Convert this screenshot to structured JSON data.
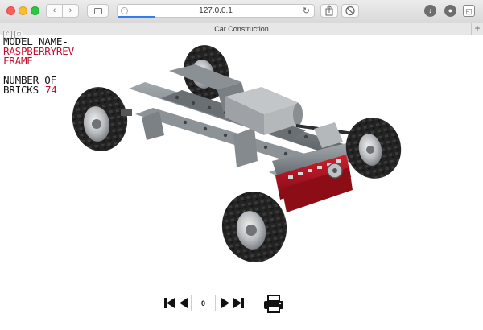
{
  "browser": {
    "url": "127.0.0.1",
    "tab_title": "Car Construction",
    "back_glyph": "‹",
    "forward_glyph": "›",
    "reload_glyph": "↻",
    "new_tab_glyph": "+",
    "icons": [
      "sidebar-icon",
      "share-icon",
      "tabs-icon",
      "download-icon",
      "extension-icon",
      "extension-icon"
    ]
  },
  "model": {
    "name_label": "MODEL NAME-",
    "name_line1": "RASPBERRYREV",
    "name_line2": "FRAME",
    "bricks_label_line1": "NUMBER OF",
    "bricks_label_line2": "BRICKS",
    "brick_count": "74"
  },
  "viewer": {
    "step": "0",
    "controls": [
      "first-step",
      "previous-step",
      "next-step",
      "last-step",
      "print"
    ]
  },
  "colors": {
    "accent_red": "#c8102e",
    "frame_gray": "#7f8488",
    "tire": "#222222",
    "rim": "#b9bcbf"
  }
}
